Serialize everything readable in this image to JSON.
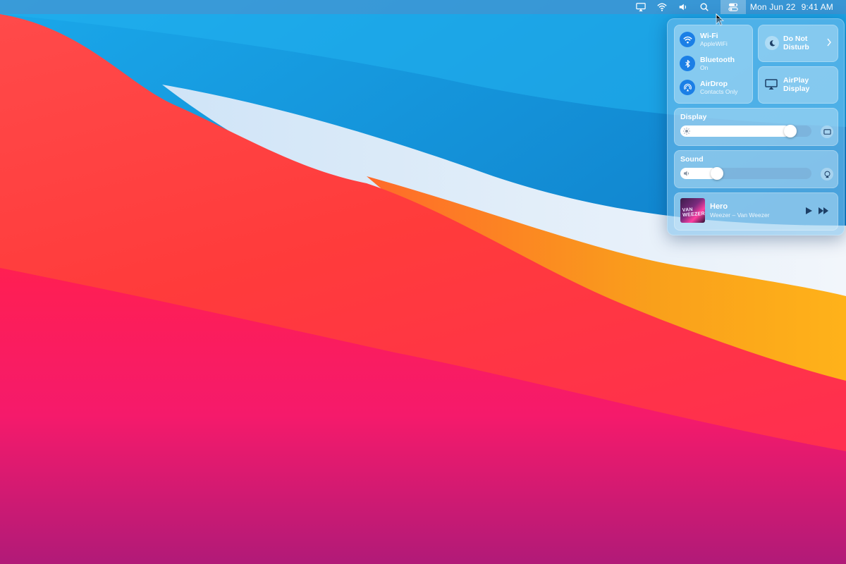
{
  "menubar": {
    "date": "Mon Jun 22",
    "time": "9:41 AM",
    "icons": [
      "airplay-icon",
      "wifi-icon",
      "volume-icon",
      "search-icon",
      "control-center-icon"
    ]
  },
  "control_center": {
    "connectivity": [
      {
        "title": "Wi-Fi",
        "subtitle": "AppleWiFi",
        "icon": "wifi-icon"
      },
      {
        "title": "Bluetooth",
        "subtitle": "On",
        "icon": "bluetooth-icon"
      },
      {
        "title": "AirDrop",
        "subtitle": "Contacts Only",
        "icon": "airdrop-icon"
      }
    ],
    "dnd": {
      "label_line1": "Do Not",
      "label_line2": "Disturb",
      "icon": "moon-icon"
    },
    "airplay": {
      "label_line1": "AirPlay",
      "label_line2": "Display",
      "icon": "airplay-display-icon"
    },
    "display": {
      "label": "Display",
      "level": 0.84
    },
    "sound": {
      "label": "Sound",
      "level": 0.28
    },
    "now_playing": {
      "title": "Hero",
      "subtitle": "Weezer – Van Weezer",
      "album_text": "VAN WEEZER"
    }
  },
  "colors": {
    "accent_blue": "#1b7fe6",
    "wallpaper_red": "#ff3b3b",
    "wallpaper_blue": "#0c8fd6",
    "wallpaper_orange": "#f9a01b"
  }
}
